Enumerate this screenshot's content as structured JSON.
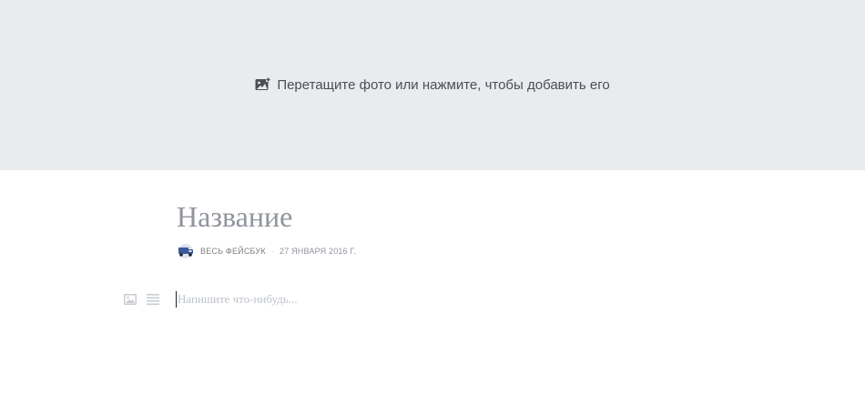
{
  "cover": {
    "hint": "Перетащите фото или нажмите, чтобы добавить его",
    "icon": "add-photo-icon"
  },
  "note": {
    "title_placeholder": "Название",
    "author": "ВЕСЬ ФЕЙСБУК",
    "separator": "·",
    "date": "27 ЯНВАРЯ 2016 Г.",
    "body_placeholder": "Напишите что-нибудь..."
  },
  "toolbar": {
    "items": [
      "image-icon",
      "paragraph-icon"
    ]
  },
  "colors": {
    "cover_bg": "#e9ebee",
    "muted_text": "#90949c",
    "placeholder": "#bec2c9"
  }
}
